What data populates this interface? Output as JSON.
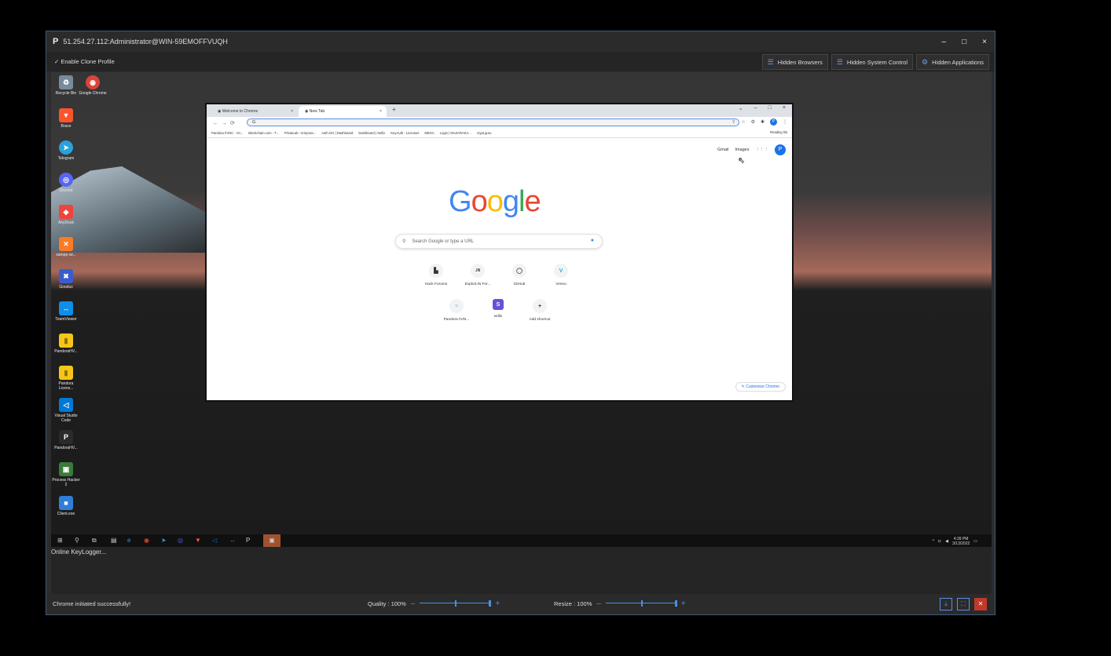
{
  "window": {
    "title": "51.254.27.112:Administrator@WIN-59EMOFFVUQH",
    "controls": [
      "–",
      "□",
      "×"
    ]
  },
  "toolbar": {
    "clone_profile": "✓ Enable Clone Profile",
    "hidden_browsers": "Hidden Browsers",
    "hidden_system_control": "Hidden System Control",
    "hidden_applications": "Hidden Applications"
  },
  "desktop": {
    "icons": [
      {
        "label": "Recycle Bin",
        "color": "#7a8a99",
        "glyph": "♻"
      },
      {
        "label": "Google Chrome",
        "color": "#db4437",
        "glyph": "◉"
      },
      {
        "label": "Brave",
        "color": "#fb542b",
        "glyph": "▼"
      },
      {
        "label": "Telegram",
        "color": "#2aa1da",
        "glyph": "➤"
      },
      {
        "label": "Discord",
        "color": "#5865f2",
        "glyph": "◎"
      },
      {
        "label": "AnyDesk",
        "color": "#ef443b",
        "glyph": "◆"
      },
      {
        "label": "xampp-wi...",
        "color": "#fb7a24",
        "glyph": "✕"
      },
      {
        "label": "Goodux",
        "color": "#3b5ccc",
        "glyph": "✖"
      },
      {
        "label": "TeamViewer",
        "color": "#0e8ee9",
        "glyph": "↔"
      },
      {
        "label": "PandoraHV...",
        "color": "#f5c518",
        "glyph": "▮"
      },
      {
        "label": "Pandora Licens...",
        "color": "#f5c518",
        "glyph": "▮"
      },
      {
        "label": "Visual Studio Code",
        "color": "#0078d4",
        "glyph": "◁"
      },
      {
        "label": "PandoraHV...",
        "color": "#2b2b2b",
        "glyph": "P"
      },
      {
        "label": "Process Hacker 2",
        "color": "#3a7a3a",
        "glyph": "▣"
      },
      {
        "label": "Client.exe",
        "color": "#2f7ed8",
        "glyph": "■"
      }
    ]
  },
  "chrome": {
    "tabs": [
      "Welcome to Chrome",
      "New Tab"
    ],
    "address_value": "G",
    "bookmarks": [
      "Pandora hVNC - Vo...",
      "Blockchain.com - T...",
      "PrivatLab - tempora...",
      "Auth.GG | Dashboard",
      "Dashboard | Sellix",
      "KeyAuth - Licenses",
      "MEGA",
      "Login | MAZARAKA...",
      "crypt.guru"
    ],
    "reading_list": "Reading list",
    "gmail": "Gmail",
    "images": "Images",
    "avatar": "P",
    "logo": [
      "G",
      "o",
      "o",
      "g",
      "l",
      "e"
    ],
    "logo_colors": [
      "#4285f4",
      "#ea4335",
      "#fbbc05",
      "#4285f4",
      "#34a853",
      "#ea4335"
    ],
    "search_placeholder": "Search Google or type a URL",
    "shortcuts": [
      {
        "label": "Hack Forums",
        "glyph": "▙"
      },
      {
        "label": "Exploit.IN For...",
        "glyph": ".IN"
      },
      {
        "label": "GitHub",
        "glyph": "◯"
      },
      {
        "label": "Vimeo",
        "glyph": "V"
      },
      {
        "label": "Pandora hVN...",
        "glyph": "≡"
      },
      {
        "label": "sellix",
        "glyph": "S"
      },
      {
        "label": "Add shortcut",
        "glyph": "+"
      }
    ],
    "customize": "✎ Customize Chrome"
  },
  "taskbar": {
    "time": "4:39 PM",
    "date": "3/13/2022"
  },
  "log": {
    "text": "Online KeyLogger..."
  },
  "status": {
    "message": "Chrome initiated successfully!",
    "quality_label": "Quality : 100%",
    "resize_label": "Resize : 100%",
    "quality_value": 100,
    "resize_value": 100
  }
}
